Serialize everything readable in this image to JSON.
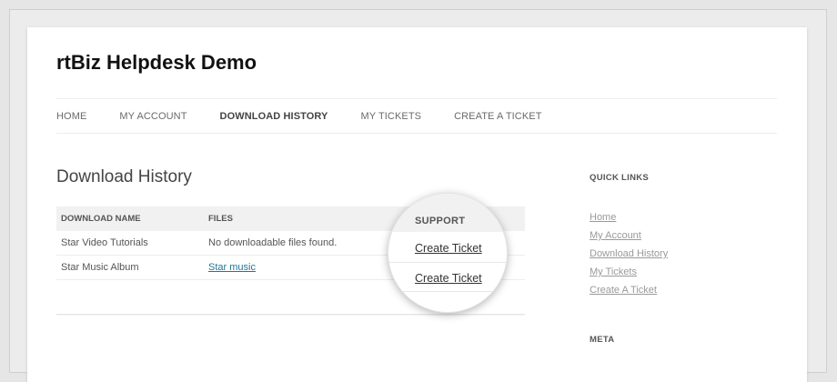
{
  "site": {
    "title": "rtBiz Helpdesk Demo"
  },
  "nav": {
    "items": [
      {
        "label": "HOME"
      },
      {
        "label": "MY ACCOUNT"
      },
      {
        "label": "DOWNLOAD HISTORY",
        "current": true
      },
      {
        "label": "MY TICKETS"
      },
      {
        "label": "CREATE A TICKET"
      }
    ]
  },
  "main": {
    "heading": "Download History",
    "table": {
      "headers": [
        "DOWNLOAD NAME",
        "FILES"
      ],
      "rows": [
        {
          "name": "Star Video Tutorials",
          "files": "No downloadable files found."
        },
        {
          "name": "Star Music Album",
          "files": "Star music",
          "files_is_link": true
        }
      ]
    },
    "magnifier": {
      "header": "SUPPORT",
      "links": [
        "Create Ticket",
        "Create Ticket"
      ]
    }
  },
  "sidebar": {
    "quick_links": {
      "title": "QUICK LINKS",
      "items": [
        "Home",
        "My Account",
        "Download History",
        "My Tickets",
        "Create A Ticket"
      ]
    },
    "meta": {
      "title": "META"
    }
  },
  "colors": {
    "link": "#21759b",
    "sidebar_link": "#9a9a9a",
    "table_header_bg": "#f1f1f1"
  }
}
